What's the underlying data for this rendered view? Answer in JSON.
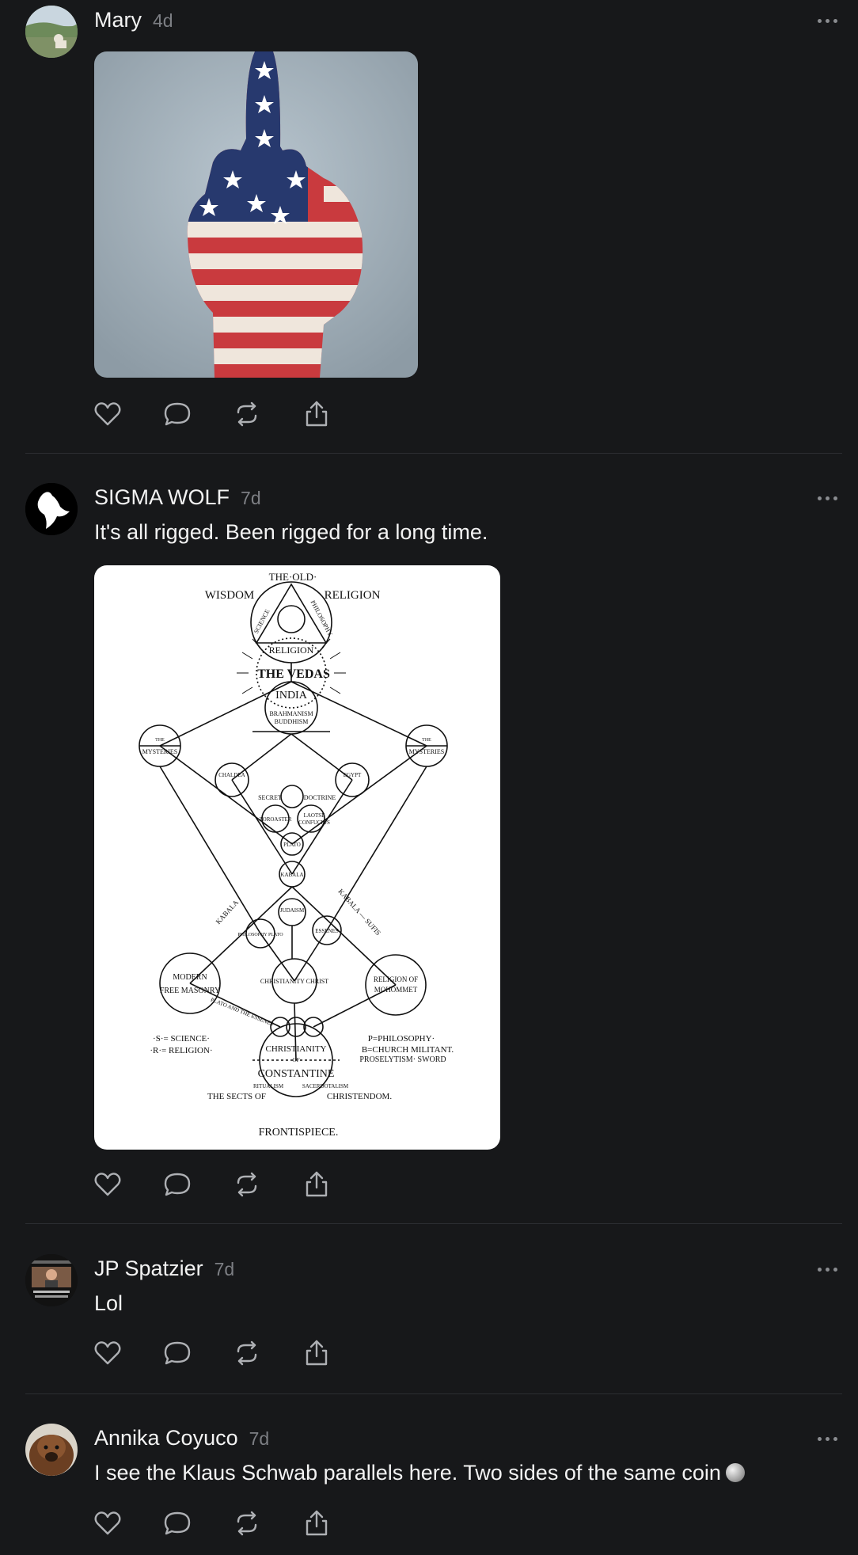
{
  "posts": [
    {
      "author": "Mary",
      "time": "4d",
      "text": "",
      "media": "American flag painted hand"
    },
    {
      "author": "SIGMA WOLF",
      "time": "7d",
      "text": "It's all rigged. Been rigged for a long time.",
      "media": "Frontispiece diagram",
      "diagram": {
        "top": "THE·OLD·",
        "wisdom": "WISDOM",
        "religion_top": "RELIGION",
        "science": "SCIENCE",
        "philosophy": "PHILOSOPHY",
        "religion_ring": "RELIGION",
        "vedas": "THE VEDAS",
        "india": "INDIA",
        "brahmanism": "BRAHMANISM",
        "buddhism": "BUDDHISM",
        "mysteries_left": "MYSTERIES",
        "mysteries_right": "MYSTERIES",
        "the_left": "THE",
        "the_right": "THE",
        "chaldea": "CHALDEA",
        "egypt": "EGYPT",
        "secret": "SECRET",
        "doctrine": "DOCTRINE",
        "zoroaster": "ZOROASTER",
        "laotse": "LAOTSE",
        "confucius": "CONFUCIUS",
        "plato": "PLATO",
        "kabala": "KABALA",
        "judaism": "JUDAISM",
        "philosophy_plato": "PHILOSOPHY PLATO",
        "essenes": "ESSENES",
        "kabala_left": "KABALA",
        "kabala_sufis": "KABALA — SUFIS",
        "modern": "MODERN",
        "free_masonry": "FREE MASONRY",
        "christianity_christ": "CHRISTIANITY CHRIST",
        "religion_of": "RELIGION OF",
        "mohommet": "MOHOMMET",
        "plato_essenes": "PLATO AND THE ESSENES",
        "christianity": "CHRISTIANITY",
        "of": "OF",
        "constantine": "CONSTANTINE",
        "ritualism": "RITUALISM",
        "sacerdotalism": "SACERDOTALISM",
        "sects": "THE SECTS OF",
        "christendom": "CHRISTENDOM.",
        "legend_s": "·S·= SCIENCE·",
        "legend_r": "·R·= RELIGION·",
        "legend_p": "P=PHILOSOPHY·",
        "legend_b": "B=CHURCH MILITANT.",
        "legend_b2": "PROSELYTISM· SWORD",
        "caption": "FRONTISPIECE."
      }
    },
    {
      "author": "JP Spatzier",
      "time": "7d",
      "text": "Lol"
    },
    {
      "author": "Annika Coyuco",
      "time": "7d",
      "text": "I see the Klaus Schwab parallels here. Two sides of the same coin"
    }
  ],
  "icons": {
    "like": "heart-icon",
    "reply": "comment-icon",
    "repost": "repost-icon",
    "share": "share-icon",
    "more": "more-icon"
  },
  "colors": {
    "background": "#17181a",
    "text": "#f3f3f3",
    "muted": "#7d7f84",
    "divider": "#2c2e32"
  }
}
